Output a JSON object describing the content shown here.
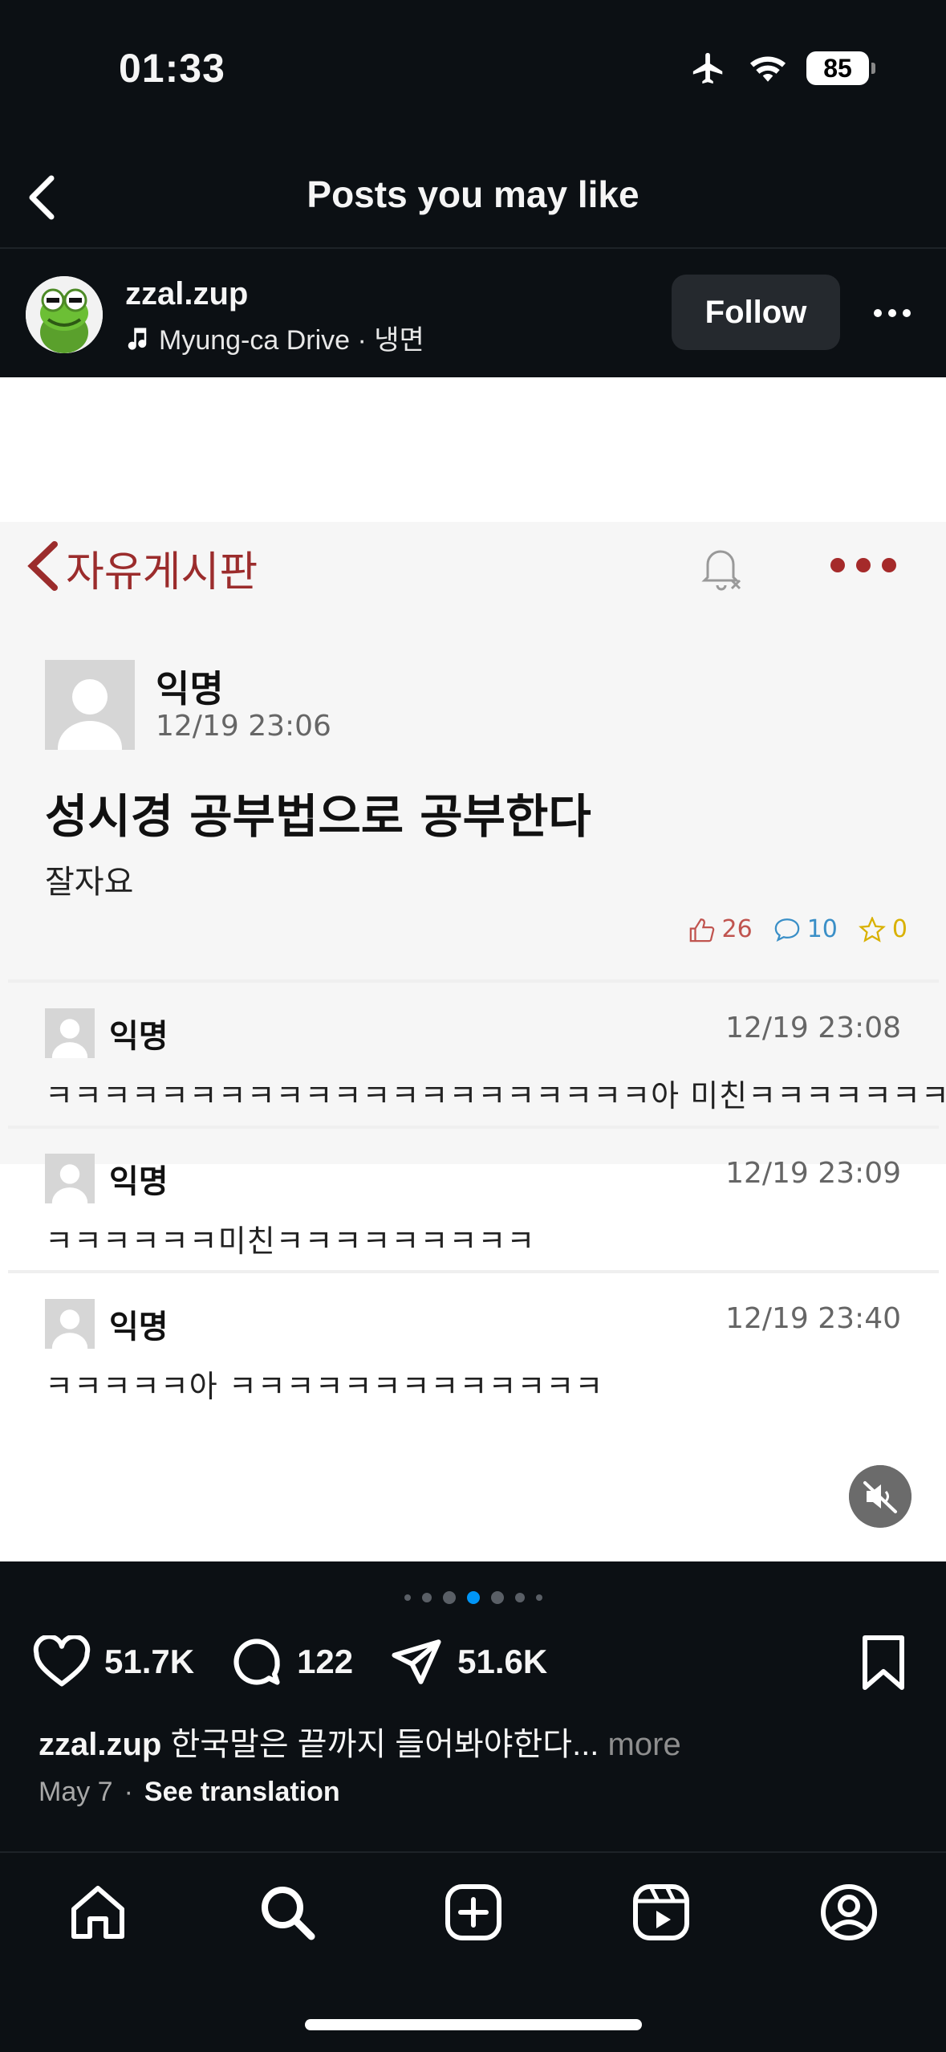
{
  "status_bar": {
    "time": "01:33",
    "battery": "85"
  },
  "header": {
    "title": "Posts you may like"
  },
  "post": {
    "username": "zzal.zup",
    "music": "Myung-ca Drive · 냉면",
    "follow_label": "Follow",
    "carousel": {
      "count": 7,
      "active_index": 4
    },
    "likes": "51.7K",
    "comments": "122",
    "shares": "51.6K",
    "caption_user": "zzal.zup",
    "caption_text": " 한국말은 끝까지 들어봐야한다...",
    "caption_more": " more",
    "date": "May 7",
    "meta_separator": "·",
    "see_translation": "See translation"
  },
  "image_content": {
    "board_name": "자유게시판",
    "post": {
      "author": "익명",
      "date": "12/19 23:06",
      "title": "성시경 공부법으로 공부한다",
      "body": "잘자요",
      "likes": "26",
      "comments": "10",
      "stars": "0"
    },
    "comments": [
      {
        "author": "익명",
        "date": "12/19 23:08",
        "text": "ㅋㅋㅋㅋㅋㅋㅋㅋㅋㅋㅋㅋㅋㅋㅋㅋㅋㅋㅋㅋㅋ아 미친ㅋㅋㅋㅋㅋㅋㅋㅋ"
      },
      {
        "author": "익명",
        "date": "12/19 23:09",
        "text": "ㅋㅋㅋㅋㅋㅋ미친ㅋㅋㅋㅋㅋㅋㅋㅋㅋ"
      },
      {
        "author": "익명",
        "date": "12/19 23:40",
        "text": "ㅋㅋㅋㅋㅋ아 ㅋㅋㅋㅋㅋㅋㅋㅋㅋㅋㅋㅋㅋ"
      }
    ]
  },
  "tab_bar": [
    "home-icon",
    "search-icon",
    "create-icon",
    "reels-icon",
    "profile-icon"
  ],
  "colors": {
    "background": "#0c1014",
    "accent_dot": "#0095f6",
    "board_red": "#9b2c2c"
  }
}
